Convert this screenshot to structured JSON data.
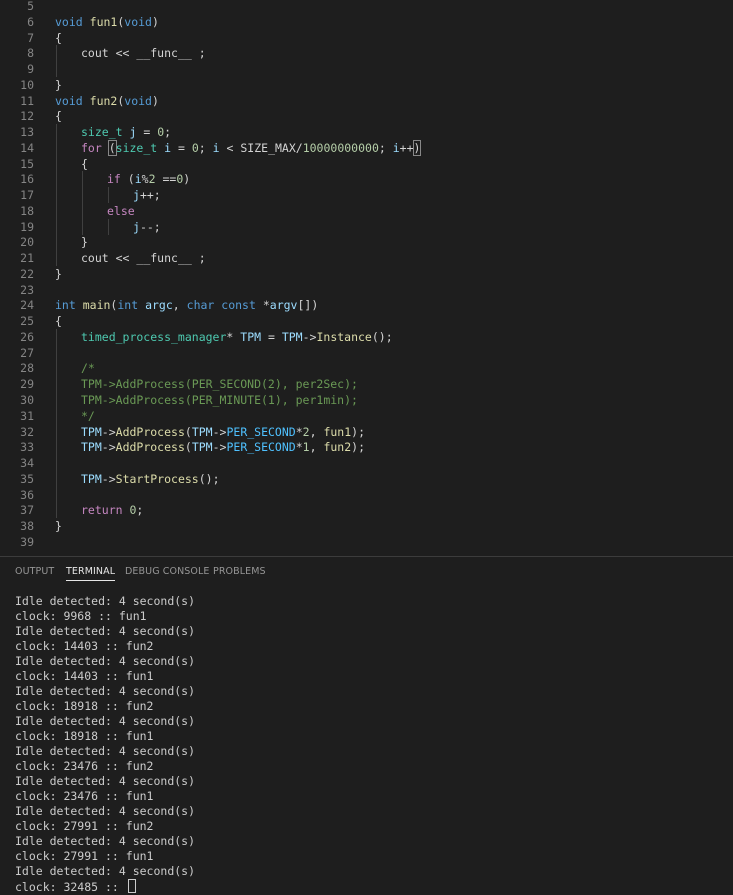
{
  "editor": {
    "lines": [
      {
        "n": "5",
        "indent": 0,
        "tokens": []
      },
      {
        "n": "6",
        "indent": 0,
        "tokens": [
          [
            "void",
            "k-kw"
          ],
          [
            " ",
            "k-plain"
          ],
          [
            "fun1",
            "k-fn"
          ],
          [
            "(",
            "k-plain"
          ],
          [
            "void",
            "k-kw"
          ],
          [
            ")",
            "k-plain"
          ]
        ]
      },
      {
        "n": "7",
        "indent": 0,
        "tokens": [
          [
            "{",
            "k-plain"
          ]
        ]
      },
      {
        "n": "8",
        "indent": 1,
        "tokens": [
          [
            "cout",
            "k-plain"
          ],
          [
            " << ",
            "k-plain"
          ],
          [
            "__func__",
            "k-plain"
          ],
          [
            " ;",
            "k-plain"
          ]
        ]
      },
      {
        "n": "9",
        "indent": 1,
        "tokens": []
      },
      {
        "n": "10",
        "indent": 0,
        "tokens": [
          [
            "}",
            "k-plain"
          ]
        ]
      },
      {
        "n": "11",
        "indent": 0,
        "tokens": [
          [
            "void",
            "k-kw"
          ],
          [
            " ",
            "k-plain"
          ],
          [
            "fun2",
            "k-fn"
          ],
          [
            "(",
            "k-plain"
          ],
          [
            "void",
            "k-kw"
          ],
          [
            ")",
            "k-plain"
          ]
        ]
      },
      {
        "n": "12",
        "indent": 0,
        "tokens": [
          [
            "{",
            "k-plain"
          ]
        ]
      },
      {
        "n": "13",
        "indent": 1,
        "tokens": [
          [
            "size_t",
            "k-type"
          ],
          [
            " ",
            "k-plain"
          ],
          [
            "j",
            "k-var"
          ],
          [
            " = ",
            "k-plain"
          ],
          [
            "0",
            "k-num"
          ],
          [
            ";",
            "k-plain"
          ]
        ]
      },
      {
        "n": "14",
        "indent": 1,
        "tokens": [
          [
            "for",
            "k-ctrl"
          ],
          [
            " ",
            "k-plain"
          ],
          [
            "(",
            "bracket"
          ],
          [
            "size_t",
            "k-type"
          ],
          [
            " ",
            "k-plain"
          ],
          [
            "i",
            "k-var"
          ],
          [
            " = ",
            "k-plain"
          ],
          [
            "0",
            "k-num"
          ],
          [
            "; ",
            "k-plain"
          ],
          [
            "i",
            "k-var"
          ],
          [
            " < ",
            "k-plain"
          ],
          [
            "SIZE_MAX",
            "k-plain"
          ],
          [
            "/",
            "k-plain"
          ],
          [
            "10000000000",
            "k-num"
          ],
          [
            "; ",
            "k-plain"
          ],
          [
            "i",
            "k-var"
          ],
          [
            "++",
            "k-plain"
          ],
          [
            ")",
            "bracket"
          ]
        ]
      },
      {
        "n": "15",
        "indent": 1,
        "tokens": [
          [
            "{",
            "k-plain"
          ]
        ]
      },
      {
        "n": "16",
        "indent": 2,
        "tokens": [
          [
            "if",
            "k-ctrl"
          ],
          [
            " (",
            "k-plain"
          ],
          [
            "i",
            "k-var"
          ],
          [
            "%",
            "k-plain"
          ],
          [
            "2",
            "k-num"
          ],
          [
            " ==",
            "k-plain"
          ],
          [
            "0",
            "k-num"
          ],
          [
            ")",
            "k-plain"
          ]
        ]
      },
      {
        "n": "17",
        "indent": 3,
        "tokens": [
          [
            "j",
            "k-var"
          ],
          [
            "++;",
            "k-plain"
          ]
        ]
      },
      {
        "n": "18",
        "indent": 2,
        "tokens": [
          [
            "else",
            "k-ctrl"
          ]
        ]
      },
      {
        "n": "19",
        "indent": 3,
        "tokens": [
          [
            "j",
            "k-var"
          ],
          [
            "--;",
            "k-plain"
          ]
        ]
      },
      {
        "n": "20",
        "indent": 1,
        "tokens": [
          [
            "}",
            "k-plain"
          ]
        ]
      },
      {
        "n": "21",
        "indent": 1,
        "tokens": [
          [
            "cout",
            "k-plain"
          ],
          [
            " << ",
            "k-plain"
          ],
          [
            "__func__",
            "k-plain"
          ],
          [
            " ;",
            "k-plain"
          ]
        ]
      },
      {
        "n": "22",
        "indent": 0,
        "tokens": [
          [
            "}",
            "k-plain"
          ]
        ]
      },
      {
        "n": "23",
        "indent": 0,
        "tokens": []
      },
      {
        "n": "24",
        "indent": 0,
        "tokens": [
          [
            "int",
            "k-kw"
          ],
          [
            " ",
            "k-plain"
          ],
          [
            "main",
            "k-fn"
          ],
          [
            "(",
            "k-plain"
          ],
          [
            "int",
            "k-kw"
          ],
          [
            " ",
            "k-plain"
          ],
          [
            "argc",
            "k-var"
          ],
          [
            ", ",
            "k-plain"
          ],
          [
            "char",
            "k-kw"
          ],
          [
            " ",
            "k-plain"
          ],
          [
            "const",
            "k-kw"
          ],
          [
            " *",
            "k-plain"
          ],
          [
            "argv",
            "k-var"
          ],
          [
            "[])",
            "k-plain"
          ]
        ]
      },
      {
        "n": "25",
        "indent": 0,
        "tokens": [
          [
            "{",
            "k-plain"
          ]
        ]
      },
      {
        "n": "26",
        "indent": 1,
        "tokens": [
          [
            "timed_process_manager",
            "k-type"
          ],
          [
            "* ",
            "k-plain"
          ],
          [
            "TPM",
            "k-var"
          ],
          [
            " = ",
            "k-plain"
          ],
          [
            "TPM",
            "k-var"
          ],
          [
            "->",
            "k-plain"
          ],
          [
            "Instance",
            "k-fn"
          ],
          [
            "();",
            "k-plain"
          ]
        ]
      },
      {
        "n": "27",
        "indent": 1,
        "tokens": []
      },
      {
        "n": "28",
        "indent": 1,
        "tokens": [
          [
            "/*",
            "k-com"
          ]
        ]
      },
      {
        "n": "29",
        "indent": 1,
        "tokens": [
          [
            "TPM->AddProcess(PER_SECOND(2), per2Sec);",
            "k-com"
          ]
        ]
      },
      {
        "n": "30",
        "indent": 1,
        "tokens": [
          [
            "TPM->AddProcess(PER_MINUTE(1), per1min);",
            "k-com"
          ]
        ]
      },
      {
        "n": "31",
        "indent": 1,
        "tokens": [
          [
            "*/",
            "k-com"
          ]
        ]
      },
      {
        "n": "32",
        "indent": 1,
        "tokens": [
          [
            "TPM",
            "k-var"
          ],
          [
            "->",
            "k-plain"
          ],
          [
            "AddProcess",
            "k-fn"
          ],
          [
            "(",
            "k-plain"
          ],
          [
            "TPM",
            "k-var"
          ],
          [
            "->",
            "k-plain"
          ],
          [
            "PER_SECOND",
            "k-mac"
          ],
          [
            "*",
            "k-plain"
          ],
          [
            "2",
            "k-num"
          ],
          [
            ", ",
            "k-plain"
          ],
          [
            "fun1",
            "k-fn"
          ],
          [
            ");",
            "k-plain"
          ]
        ]
      },
      {
        "n": "33",
        "indent": 1,
        "tokens": [
          [
            "TPM",
            "k-var"
          ],
          [
            "->",
            "k-plain"
          ],
          [
            "AddProcess",
            "k-fn"
          ],
          [
            "(",
            "k-plain"
          ],
          [
            "TPM",
            "k-var"
          ],
          [
            "->",
            "k-plain"
          ],
          [
            "PER_SECOND",
            "k-mac"
          ],
          [
            "*",
            "k-plain"
          ],
          [
            "1",
            "k-num"
          ],
          [
            ", ",
            "k-plain"
          ],
          [
            "fun2",
            "k-fn"
          ],
          [
            ");",
            "k-plain"
          ]
        ]
      },
      {
        "n": "34",
        "indent": 1,
        "tokens": []
      },
      {
        "n": "35",
        "indent": 1,
        "tokens": [
          [
            "TPM",
            "k-var"
          ],
          [
            "->",
            "k-plain"
          ],
          [
            "StartProcess",
            "k-fn"
          ],
          [
            "();",
            "k-plain"
          ]
        ]
      },
      {
        "n": "36",
        "indent": 1,
        "tokens": []
      },
      {
        "n": "37",
        "indent": 1,
        "tokens": [
          [
            "return",
            "k-ctrl"
          ],
          [
            " ",
            "k-plain"
          ],
          [
            "0",
            "k-num"
          ],
          [
            ";",
            "k-plain"
          ]
        ]
      },
      {
        "n": "38",
        "indent": 0,
        "tokens": [
          [
            "}",
            "k-plain"
          ]
        ]
      },
      {
        "n": "39",
        "indent": 0,
        "tokens": []
      }
    ]
  },
  "panel": {
    "tabs": [
      {
        "label": "OUTPUT",
        "active": false
      },
      {
        "label": "TERMINAL",
        "active": true
      },
      {
        "label": "DEBUG CONSOLE",
        "active": false
      },
      {
        "label": "PROBLEMS",
        "active": false
      }
    ],
    "terminal_lines": [
      "Idle detected: 4 second(s)",
      "clock: 9968 :: fun1",
      "Idle detected: 4 second(s)",
      "clock: 14403 :: fun2",
      "Idle detected: 4 second(s)",
      "clock: 14403 :: fun1",
      "Idle detected: 4 second(s)",
      "clock: 18918 :: fun2",
      "Idle detected: 4 second(s)",
      "clock: 18918 :: fun1",
      "Idle detected: 4 second(s)",
      "clock: 23476 :: fun2",
      "Idle detected: 4 second(s)",
      "clock: 23476 :: fun1",
      "Idle detected: 4 second(s)",
      "clock: 27991 :: fun2",
      "Idle detected: 4 second(s)",
      "clock: 27991 :: fun1",
      "Idle detected: 4 second(s)",
      "clock: 32485 :: "
    ]
  }
}
